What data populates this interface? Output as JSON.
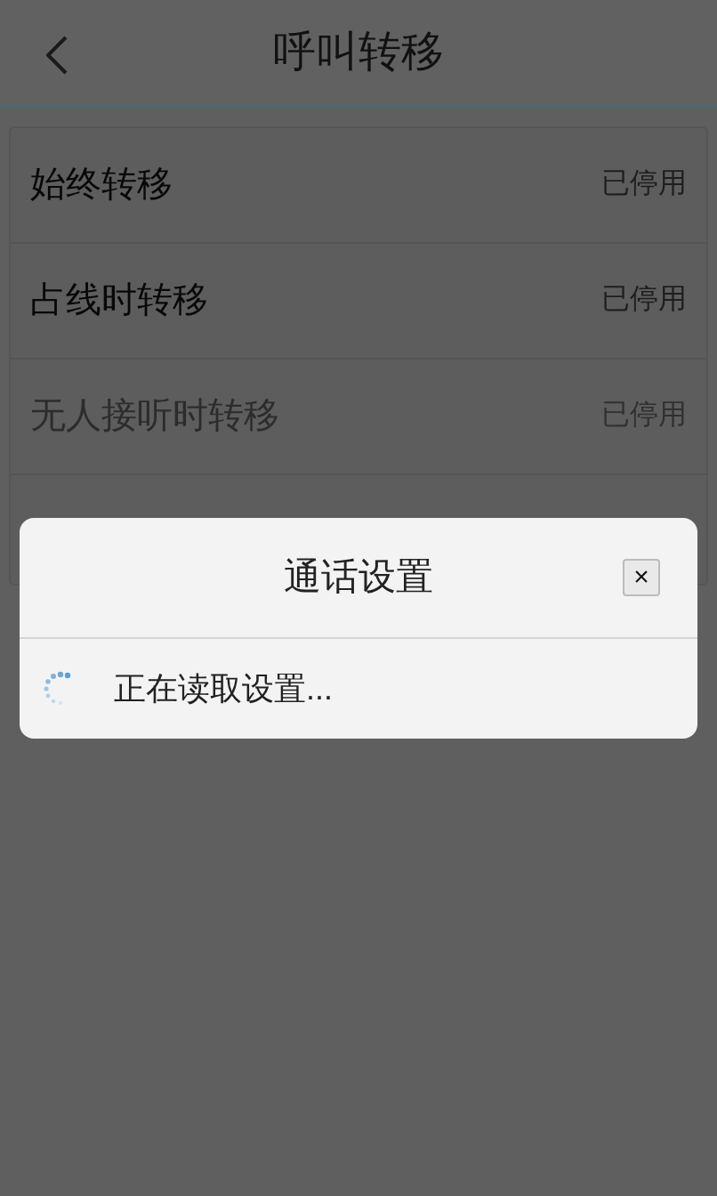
{
  "header": {
    "title": "呼叫转移"
  },
  "rows": [
    {
      "label": "始终转移",
      "status": "已停用",
      "disabled": false
    },
    {
      "label": "占线时转移",
      "status": "已停用",
      "disabled": false
    },
    {
      "label": "无人接听时转移",
      "status": "已停用",
      "disabled": true
    }
  ],
  "dialog": {
    "title": "通话设置",
    "close": "×",
    "message": "正在读取设置..."
  }
}
